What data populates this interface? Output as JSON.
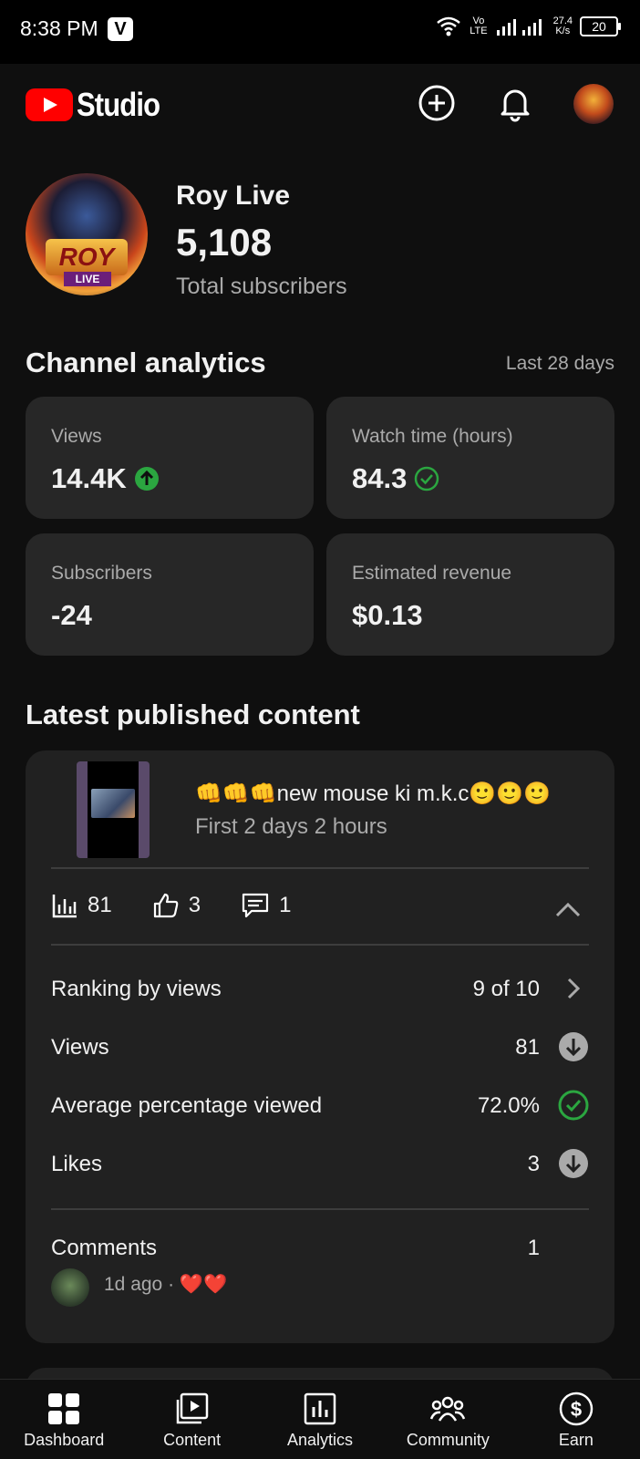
{
  "status_bar": {
    "time": "8:38 PM",
    "app_badge": "V",
    "network_speed_top": "27.4",
    "network_speed_bottom": "K/s",
    "volte_top": "Vo",
    "volte_bottom": "LTE",
    "battery": "20"
  },
  "app_bar": {
    "logo_text": "Studio"
  },
  "channel": {
    "name": "Roy Live",
    "avatar_badge_line1": "ROY",
    "avatar_badge_line2": "LIVE",
    "subscribers": "5,108",
    "subscribers_label": "Total subscribers"
  },
  "analytics": {
    "title": "Channel analytics",
    "range": "Last 28 days",
    "cards": [
      {
        "label": "Views",
        "value": "14.4K",
        "trend": "up-icon"
      },
      {
        "label": "Watch time (hours)",
        "value": "84.3",
        "trend": "check-icon"
      },
      {
        "label": "Subscribers",
        "value": "-24"
      },
      {
        "label": "Estimated revenue",
        "value": "$0.13"
      }
    ]
  },
  "latest": {
    "title": "Latest published content",
    "video_title": "👊👊👊new mouse ki m.k.c🙂🙂🙂",
    "video_subtitle": "First 2 days 2 hours",
    "metrics": {
      "views": "81",
      "likes": "3",
      "comments": "1"
    },
    "rows": [
      {
        "label": "Ranking by views",
        "value": "9 of 10",
        "icon": "chevron-right-icon"
      },
      {
        "label": "Views",
        "value": "81",
        "icon": "arrow-down-icon"
      },
      {
        "label": "Average percentage viewed",
        "value": "72.0%",
        "icon": "check-circle-icon"
      },
      {
        "label": "Likes",
        "value": "3",
        "icon": "arrow-down-icon"
      }
    ],
    "comments_label": "Comments",
    "comments_value": "1",
    "comment_meta": "1d ago · ",
    "comment_text": "❤️❤️"
  },
  "bottom_nav": [
    {
      "label": "Dashboard",
      "icon": "dashboard-icon"
    },
    {
      "label": "Content",
      "icon": "content-icon"
    },
    {
      "label": "Analytics",
      "icon": "analytics-icon"
    },
    {
      "label": "Community",
      "icon": "community-icon"
    },
    {
      "label": "Earn",
      "icon": "earn-icon"
    }
  ],
  "colors": {
    "background": "#0f0f0f",
    "card": "#272727",
    "brand_red": "#ff0000",
    "success_green": "#2ba640",
    "secondary_text": "#aaaaaa"
  }
}
